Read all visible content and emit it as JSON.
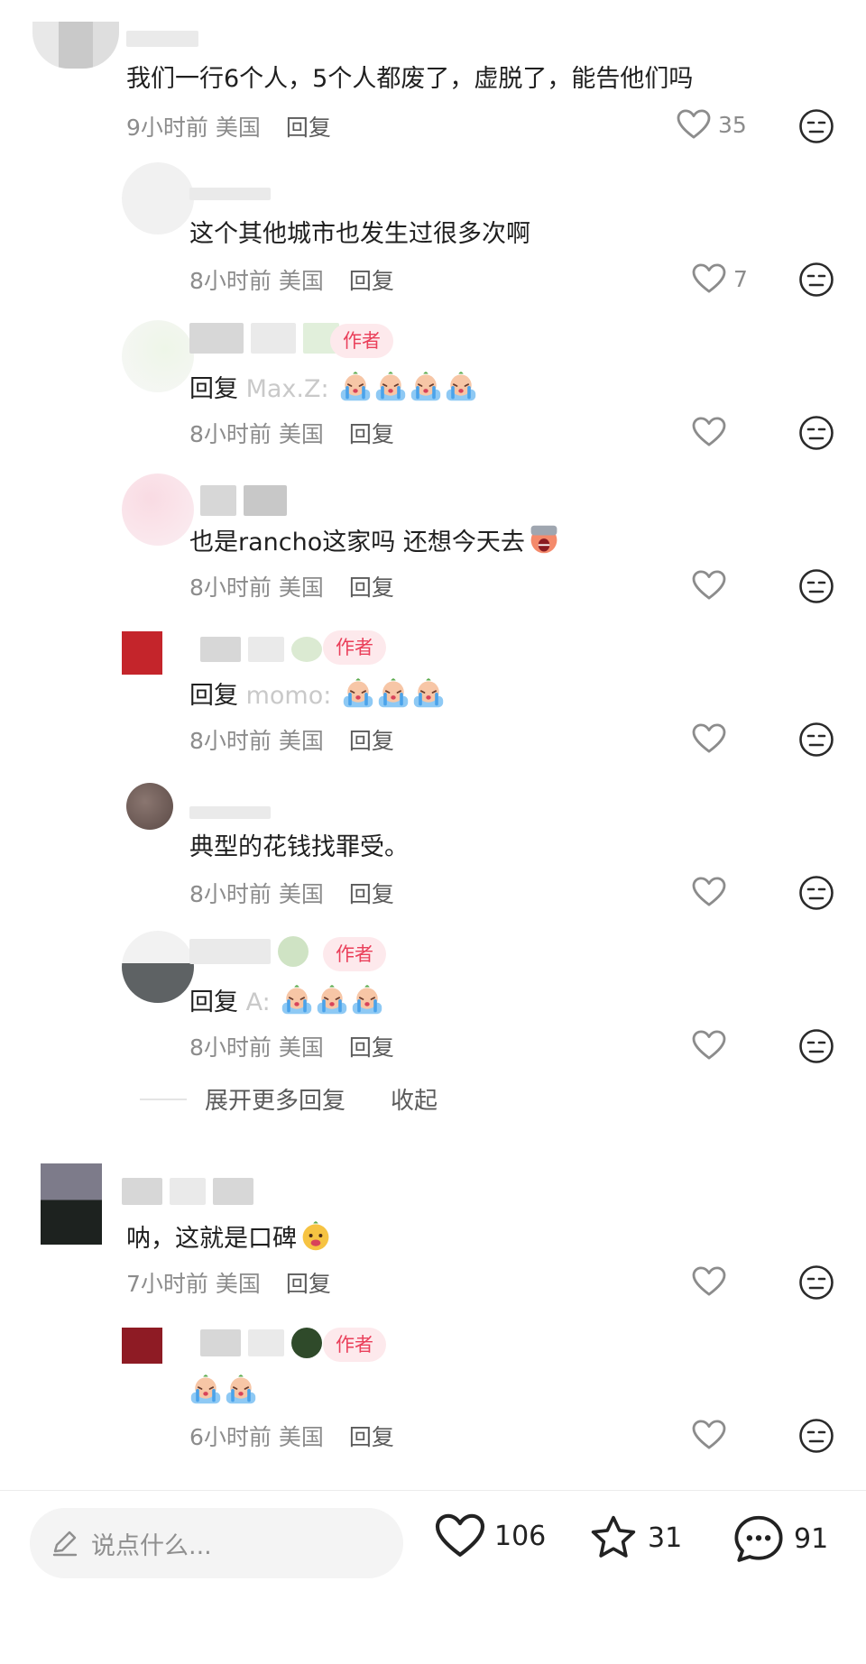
{
  "comments": [
    {
      "text": "我们一行6个人，5个人都废了，虚脱了，能告他们吗",
      "time": "9小时前",
      "location": "美国",
      "reply_label": "回复",
      "likes": "35"
    },
    {
      "text": "这个其他城市也发生过很多次啊",
      "time": "8小时前",
      "location": "美国",
      "reply_label": "回复",
      "likes": "7"
    },
    {
      "tag": "作者",
      "reply_prefix": "回复",
      "reply_to": "Max.Z:",
      "time": "8小时前",
      "location": "美国",
      "reply_label": "回复"
    },
    {
      "text": "也是rancho这家吗 还想今天去",
      "time": "8小时前",
      "location": "美国",
      "reply_label": "回复"
    },
    {
      "tag": "作者",
      "reply_prefix": "回复",
      "reply_to": "momo:",
      "time": "8小时前",
      "location": "美国",
      "reply_label": "回复"
    },
    {
      "text": "典型的花钱找罪受。",
      "time": "8小时前",
      "location": "美国",
      "reply_label": "回复"
    },
    {
      "tag": "作者",
      "reply_prefix": "回复",
      "reply_to": "A:",
      "time": "8小时前",
      "location": "美国",
      "reply_label": "回复"
    },
    {
      "text": "呐，这就是口碑",
      "time": "7小时前",
      "location": "美国",
      "reply_label": "回复"
    },
    {
      "tag": "作者",
      "time": "6小时前",
      "location": "美国",
      "reply_label": "回复"
    }
  ],
  "expand": {
    "more_label": "展开更多回复",
    "collapse_label": "收起"
  },
  "bottom_bar": {
    "placeholder": "说点什么...",
    "likes": "106",
    "stars": "31",
    "comments": "91"
  },
  "colors": {
    "author_tag": "#ea3f5a",
    "author_tag_bg": "#fde9ec",
    "meta": "#8c8c8c"
  },
  "icons": [
    "heart-icon",
    "neutral-face-icon",
    "crying-emoji",
    "screaming-emoji",
    "smiling-emoji",
    "pencil-icon",
    "star-icon",
    "chat-bubble-icon"
  ]
}
